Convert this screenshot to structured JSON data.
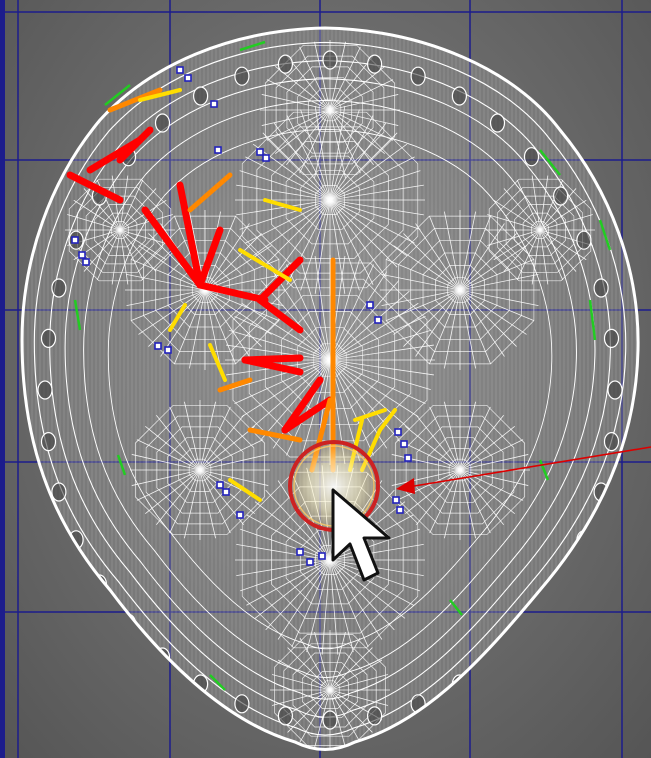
{
  "viewport": {
    "background_color": "#6e6e6e",
    "grid_color": "#1c1c8c",
    "wireframe_color": "#ffffff",
    "edge_highlight_color": "#22cc22",
    "selection_colors": [
      "#ff0000",
      "#ff8800",
      "#ffdd00"
    ],
    "vertex_handle_color": "#2222bb",
    "annotation_color": "#dd0000"
  },
  "brush_cursor": {
    "ring_color": "#cc2222",
    "icon": "arrow-cursor-icon"
  },
  "annotation_arrow": {
    "icon": "red-arrow-icon"
  }
}
